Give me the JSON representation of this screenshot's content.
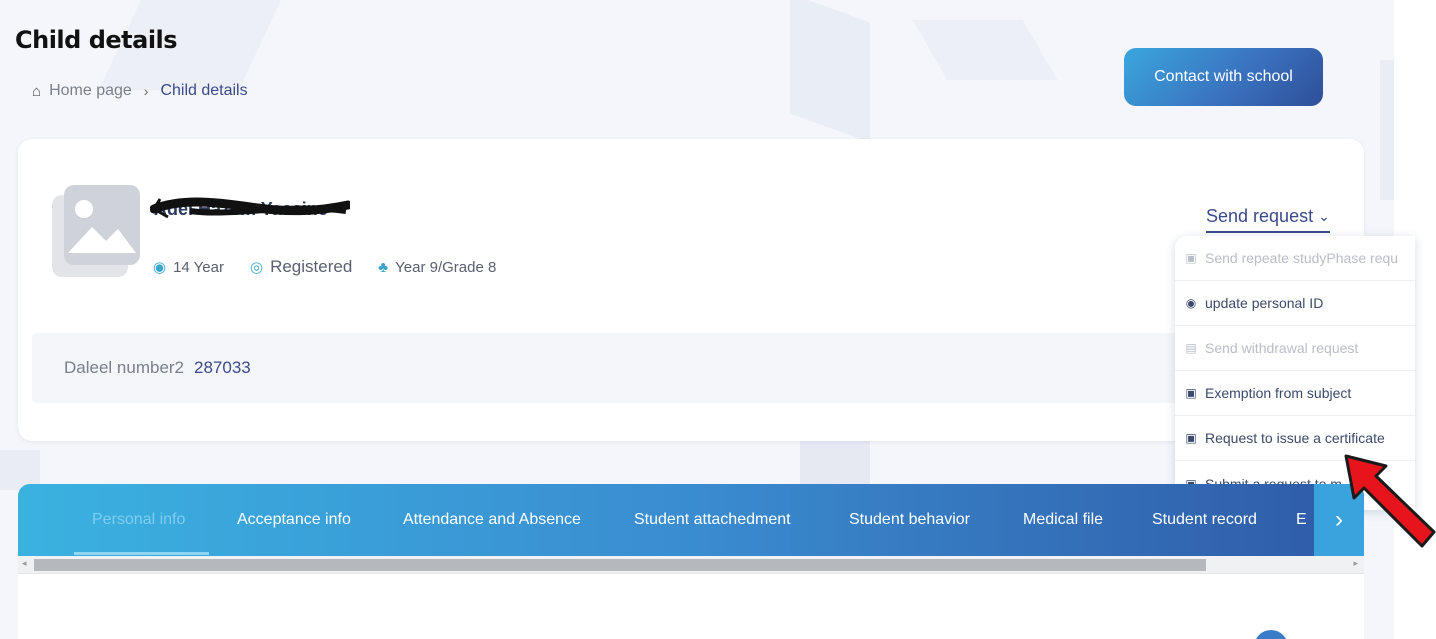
{
  "page": {
    "title": "Child details",
    "breadcrumb": {
      "home": "Home page",
      "current": "Child details"
    },
    "contact_button": "Contact with school"
  },
  "profile": {
    "name": "Adel Hazem Yassine",
    "age": "14 Year",
    "status": "Registered",
    "grade": "Year 9/Grade 8",
    "daleel_label": "Daleel number2",
    "daleel_value": "287033"
  },
  "send_request": {
    "label": "Send request",
    "items": [
      {
        "label": "Send repeate studyPhase requ",
        "icon": "document-icon",
        "disabled": true
      },
      {
        "label": "update personal ID",
        "icon": "id-badge-icon",
        "disabled": false
      },
      {
        "label": "Send withdrawal request",
        "icon": "clipboard-icon",
        "disabled": true
      },
      {
        "label": "Exemption from subject",
        "icon": "document-icon",
        "disabled": false
      },
      {
        "label": "Request to issue a certificate",
        "icon": "document-icon",
        "disabled": false
      },
      {
        "label": "Submit a request to m",
        "icon": "document-icon",
        "disabled": false
      }
    ]
  },
  "tabs": [
    {
      "label": "Personal info",
      "active": true
    },
    {
      "label": "Acceptance info",
      "active": false
    },
    {
      "label": "Attendance and Absence",
      "active": false
    },
    {
      "label": "Student attachedment",
      "active": false
    },
    {
      "label": "Student behavior",
      "active": false
    },
    {
      "label": "Medical file",
      "active": false
    },
    {
      "label": "Student record",
      "active": false
    },
    {
      "label": "E",
      "active": false
    }
  ],
  "colors": {
    "accent": "#3a73c0",
    "tab_gradient_start": "#3ab2e0",
    "tab_gradient_end": "#2f5aa6",
    "text_dark_blue": "#3b4a8a",
    "annotation_arrow": "#e8141c"
  }
}
